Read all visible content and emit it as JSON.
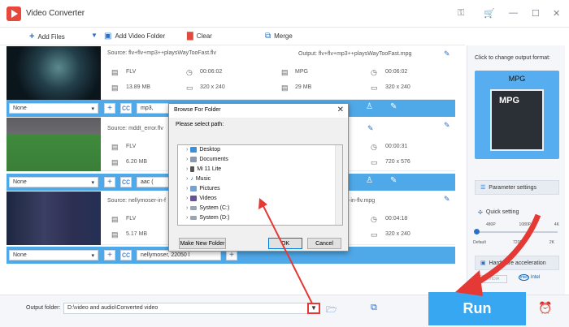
{
  "app": {
    "title": "Video Converter"
  },
  "toolbar": {
    "add_files": "Add Files",
    "add_folder": "Add Video Folder",
    "clear": "Clear",
    "merge": "Merge"
  },
  "rows": [
    {
      "source": "Source: flv+flv+mp3++playsWayTooFast.flv",
      "output": "Output: flv+flv+mp3++playsWayTooFast.mpg",
      "src_fmt": "FLV",
      "src_dur": "00:06:02",
      "src_size": "13.89 MB",
      "src_res": "320 x 240",
      "out_fmt": "MPG",
      "out_dur": "00:06:02",
      "out_size": "29 MB",
      "out_res": "320 x 240",
      "subtitle": "None",
      "audio": "mp3,"
    },
    {
      "source": "Source: mddt_error.flv",
      "src_fmt": "FLV",
      "src_size": "6.20 MB",
      "out_dur": "00:00:31",
      "out_res": "720 x 576",
      "subtitle": "None",
      "audio": "aac ("
    },
    {
      "source": "Source: nellymoser-in-f",
      "output": "-in-flv.mpg",
      "src_fmt": "FLV",
      "src_size": "5.17 MB",
      "out_dur": "00:04:18",
      "out_res": "320 x 240",
      "subtitle": "None",
      "audio": "nellymoser, 22050 l"
    }
  ],
  "right": {
    "change_label": "Click to change output format:",
    "format": "MPG",
    "param_btn": "Parameter settings",
    "quick": "Quick setting",
    "scale_top": [
      "480P",
      "1080P",
      "4K"
    ],
    "scale_bottom": [
      "Default",
      "720P",
      "2K"
    ],
    "hw_btn": "Hardware acceleration",
    "gpu1": "NVIDIA",
    "gpu2": "Intel"
  },
  "bottom": {
    "output_label": "Output folder:",
    "path": "D:\\video and audio\\Converted video",
    "run": "Run"
  },
  "dialog": {
    "title": "Browse For Folder",
    "prompt": "Please select path:",
    "items": [
      "Desktop",
      "Documents",
      "Mi 11 Lite",
      "Music",
      "Pictures",
      "Videos",
      "System (C:)",
      "System (D:)"
    ],
    "new_folder": "Make New Folder",
    "ok": "OK",
    "cancel": "Cancel"
  },
  "colors": {
    "accent": "#38a7f2",
    "option_bar": "#4fa8e8",
    "annotation": "#e53935"
  }
}
